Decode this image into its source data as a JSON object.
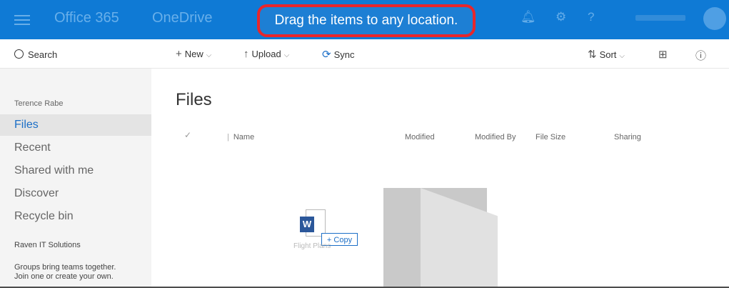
{
  "header": {
    "suite_name": "Office 365",
    "app_name": "OneDrive",
    "callout": "Drag the items to any location.",
    "icons": [
      "bell-icon",
      "gear-icon",
      "help-icon"
    ],
    "colors": {
      "bar": "#0f7ad5",
      "callout_border": "#e8262b"
    }
  },
  "command_bar": {
    "search_label": "Search",
    "new_label": "New",
    "upload_label": "Upload",
    "sync_label": "Sync",
    "sort_label": "Sort"
  },
  "sidebar": {
    "user": "Terence Rabe",
    "items": [
      {
        "label": "Files",
        "active": true
      },
      {
        "label": "Recent"
      },
      {
        "label": "Shared with me"
      },
      {
        "label": "Discover"
      },
      {
        "label": "Recycle bin"
      }
    ],
    "org": "Raven IT Solutions",
    "groups_line1": "Groups bring teams together.",
    "groups_line2": "Join one or create your own."
  },
  "main": {
    "title": "Files",
    "columns": {
      "name": "Name",
      "modified": "Modified",
      "modified_by": "Modified By",
      "file_size": "File Size",
      "sharing": "Sharing"
    }
  },
  "drag": {
    "file_icon_letter": "W",
    "badge": "+ Copy",
    "file_label": "Flight Plans"
  }
}
